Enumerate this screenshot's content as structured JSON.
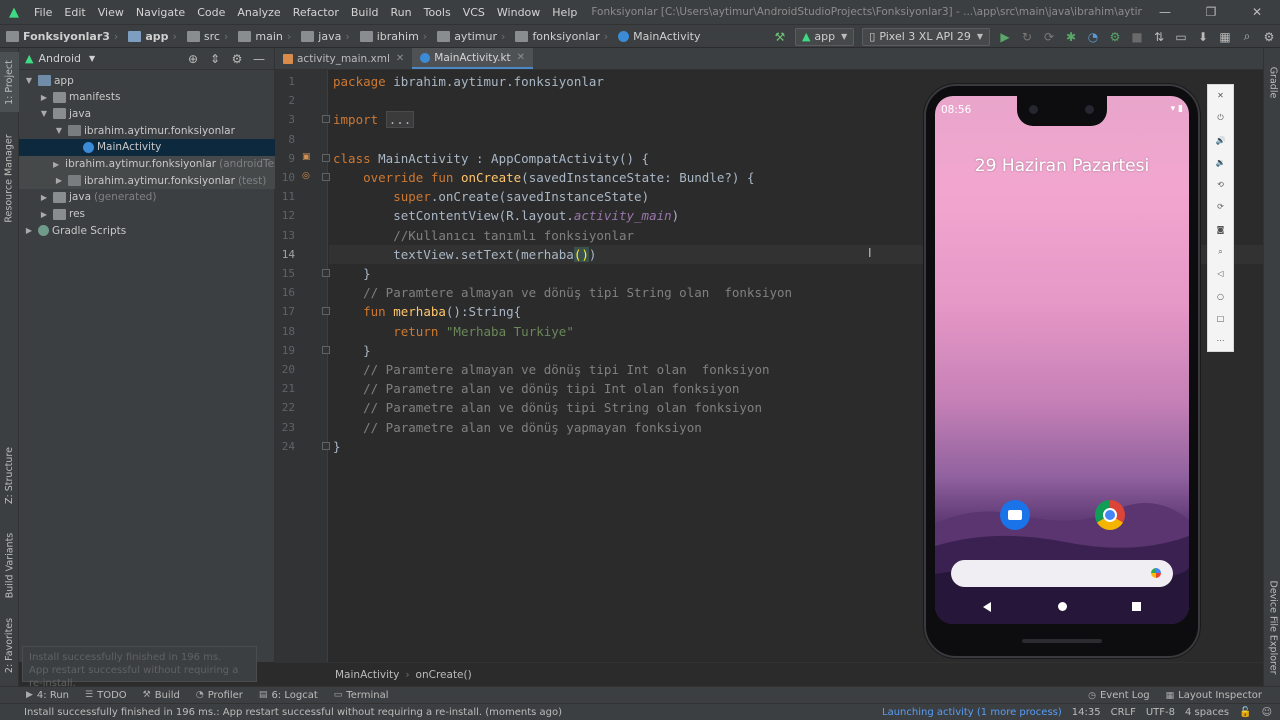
{
  "menubar": {
    "items": [
      "File",
      "Edit",
      "View",
      "Navigate",
      "Code",
      "Analyze",
      "Refactor",
      "Build",
      "Run",
      "Tools",
      "VCS",
      "Window",
      "Help"
    ],
    "title": "Fonksiyonlar [C:\\Users\\aytimur\\AndroidStudioProjects\\Fonksiyonlar3] - ...\\app\\src\\main\\java\\ibrahim\\aytimur\\fonksiyonlar\\MainActivity.kt [app]"
  },
  "navbar": {
    "crumbs": [
      "Fonksiyonlar3",
      "app",
      "src",
      "main",
      "java",
      "ibrahim",
      "aytimur",
      "fonksiyonlar",
      "MainActivity"
    ],
    "run_config": "app",
    "device": "Pixel 3 XL API 29"
  },
  "left_strip": {
    "tabs": [
      "1: Project",
      "Resource Manager",
      "Z: Structure",
      "Build Variants",
      "2: Favorites"
    ]
  },
  "right_strip": {
    "tabs": [
      "Gradle",
      "Device File Explorer"
    ]
  },
  "project_panel": {
    "view": "Android",
    "tree": [
      {
        "label": "app",
        "suffix": "",
        "depth": 0,
        "expanded": true,
        "icon": "module"
      },
      {
        "label": "manifests",
        "suffix": "",
        "depth": 1,
        "expanded": false,
        "icon": "folder"
      },
      {
        "label": "java",
        "suffix": "",
        "depth": 1,
        "expanded": true,
        "icon": "folder"
      },
      {
        "label": "ibrahim.aytimur.fonksiyonlar",
        "suffix": "",
        "depth": 2,
        "expanded": true,
        "icon": "pkg"
      },
      {
        "label": "MainActivity",
        "suffix": "",
        "depth": 3,
        "expanded": null,
        "icon": "kt",
        "selected": true
      },
      {
        "label": "ibrahim.aytimur.fonksiyonlar",
        "suffix": "(androidTest)",
        "depth": 2,
        "expanded": false,
        "icon": "pkg",
        "tinted": true
      },
      {
        "label": "ibrahim.aytimur.fonksiyonlar",
        "suffix": "(test)",
        "depth": 2,
        "expanded": false,
        "icon": "pkg",
        "tinted": true
      },
      {
        "label": "java",
        "suffix": "(generated)",
        "depth": 1,
        "expanded": false,
        "icon": "folder"
      },
      {
        "label": "res",
        "suffix": "",
        "depth": 1,
        "expanded": false,
        "icon": "folder"
      },
      {
        "label": "Gradle Scripts",
        "suffix": "",
        "depth": 0,
        "expanded": false,
        "icon": "gradle"
      }
    ],
    "toast_line1": "Install successfully finished in 196 ms.",
    "toast_line2": "App restart successful without requiring a re-install."
  },
  "editor": {
    "tabs": [
      {
        "label": "activity_main.xml",
        "active": false
      },
      {
        "label": "MainActivity.kt",
        "active": true
      }
    ],
    "current_line": 14,
    "breadcrumb": [
      "MainActivity",
      "onCreate()"
    ]
  },
  "code_lines": [
    {
      "n": 1,
      "segs": [
        [
          "kw",
          "package "
        ],
        [
          "",
          "ibrahim.aytimur.fonksiyonlar"
        ]
      ]
    },
    {
      "n": 2,
      "segs": []
    },
    {
      "n": 3,
      "segs": [
        [
          "kw",
          "import "
        ],
        [
          "fold",
          "..."
        ]
      ]
    },
    {
      "n": 8,
      "segs": []
    },
    {
      "n": 9,
      "segs": [
        [
          "kw",
          "class "
        ],
        [
          "",
          "MainActivity : AppCompatActivity() {"
        ]
      ]
    },
    {
      "n": 10,
      "segs": [
        [
          "",
          "    "
        ],
        [
          "kw",
          "override fun "
        ],
        [
          "fn",
          "onCreate"
        ],
        [
          "",
          "(savedInstanceState: Bundle?) {"
        ]
      ]
    },
    {
      "n": 11,
      "segs": [
        [
          "",
          "        "
        ],
        [
          "kw",
          "super"
        ],
        [
          "",
          ".onCreate(savedInstanceState)"
        ]
      ]
    },
    {
      "n": 12,
      "segs": [
        [
          "",
          "        setContentView(R.layout."
        ],
        [
          "it",
          "activity_main"
        ],
        [
          "",
          ")"
        ]
      ]
    },
    {
      "n": 13,
      "segs": [
        [
          "",
          "        "
        ],
        [
          "cm",
          "//Kullanıcı tanımlı fonksiyonlar"
        ]
      ]
    },
    {
      "n": 14,
      "segs": [
        [
          "",
          "        textView.setText(merhaba"
        ],
        [
          "bh",
          "()"
        ],
        [
          "",
          ")"
        ]
      ]
    },
    {
      "n": 15,
      "segs": [
        [
          "",
          "    }"
        ]
      ]
    },
    {
      "n": 16,
      "segs": [
        [
          "",
          "    "
        ],
        [
          "cm",
          "// Paramtere almayan ve dönüş tipi String olan  fonksiyon"
        ]
      ]
    },
    {
      "n": 17,
      "segs": [
        [
          "",
          "    "
        ],
        [
          "kw",
          "fun "
        ],
        [
          "fn",
          "merhaba"
        ],
        [
          "",
          "():String{"
        ]
      ]
    },
    {
      "n": 18,
      "segs": [
        [
          "",
          "        "
        ],
        [
          "kw",
          "return "
        ],
        [
          "str",
          "\"Merhaba Turkiye\""
        ]
      ]
    },
    {
      "n": 19,
      "segs": [
        [
          "",
          "    }"
        ]
      ]
    },
    {
      "n": 20,
      "segs": [
        [
          "",
          "    "
        ],
        [
          "cm",
          "// Paramtere almayan ve dönüş tipi Int olan  fonksiyon"
        ]
      ]
    },
    {
      "n": 21,
      "segs": [
        [
          "",
          "    "
        ],
        [
          "cm",
          "// Parametre alan ve dönüş tipi Int olan fonksiyon"
        ]
      ]
    },
    {
      "n": 22,
      "segs": [
        [
          "",
          "    "
        ],
        [
          "cm",
          "// Parametre alan ve dönüş tipi String olan fonksiyon"
        ]
      ]
    },
    {
      "n": 23,
      "segs": [
        [
          "",
          "    "
        ],
        [
          "cm",
          "// Parametre alan ve dönüş yapmayan fonksiyon"
        ]
      ]
    },
    {
      "n": 24,
      "segs": [
        [
          "",
          "}"
        ]
      ]
    }
  ],
  "phone": {
    "time": "08:56",
    "status_icons": "▾ ▮",
    "date": "29 Haziran Pazartesi",
    "apps": [
      "messages-icon",
      "chrome-icon"
    ]
  },
  "toolwindows": {
    "left": [
      {
        "label": "4: Run",
        "icon": "run-icon"
      },
      {
        "label": "TODO",
        "icon": "todo-icon"
      },
      {
        "label": "Build",
        "icon": "build-icon"
      },
      {
        "label": "Profiler",
        "icon": "profiler-icon"
      },
      {
        "label": "6: Logcat",
        "icon": "logcat-icon"
      },
      {
        "label": "Terminal",
        "icon": "terminal-icon"
      }
    ],
    "right": [
      {
        "label": "Event Log",
        "icon": "event-log-icon"
      },
      {
        "label": "Layout Inspector",
        "icon": "layout-inspector-icon"
      }
    ]
  },
  "statusbar": {
    "message": "Install successfully finished in 196 ms.: App restart successful without requiring a re-install. (moments ago)",
    "launching": "Launching activity (1 more process)",
    "position": "14:35",
    "line_sep": "CRLF",
    "encoding": "UTF-8",
    "indent": "4 spaces"
  }
}
